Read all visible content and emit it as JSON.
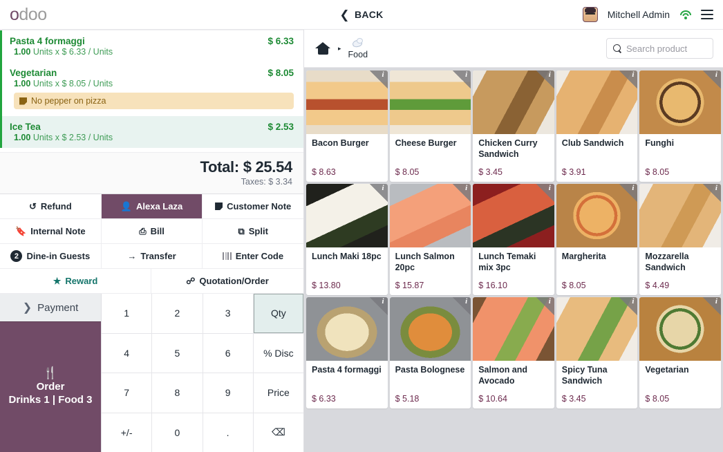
{
  "navbar": {
    "logo_primary": "o",
    "logo_rest": "doo",
    "back_label": "BACK",
    "back_icon": "chevron-left-icon",
    "user_name": "Mitchell Admin",
    "wifi_icon": "wifi-icon",
    "menu_icon": "hamburger-menu-icon",
    "accent_color": "#714B67",
    "wifi_color": "#28a745"
  },
  "order": {
    "lines": [
      {
        "name": "Pasta 4 formaggi",
        "price": "$ 6.33",
        "qty": "1.00",
        "detail": "Units x $ 6.33 / Units",
        "selected": false,
        "note": null
      },
      {
        "name": "Vegetarian",
        "price": "$ 8.05",
        "qty": "1.00",
        "detail": "Units x $ 8.05 / Units",
        "selected": false,
        "note": "No pepper on pizza"
      },
      {
        "name": "Ice Tea",
        "price": "$ 2.53",
        "qty": "1.00",
        "detail": "Units x $ 2.53 / Units",
        "selected": true,
        "note": null
      }
    ],
    "total_label": "Total: $ 25.54",
    "taxes_label": "Taxes: $ 3.34"
  },
  "actions": {
    "rows": [
      [
        {
          "label": "Refund",
          "icon": "refund-icon",
          "glyph": "↺",
          "state": "default"
        },
        {
          "label": "Alexa Laza",
          "icon": "customer-icon",
          "glyph": "👤",
          "state": "active"
        },
        {
          "label": "Customer Note",
          "icon": "note-icon",
          "glyph": "note",
          "state": "default"
        }
      ],
      [
        {
          "label": "Internal Note",
          "icon": "tag-icon",
          "glyph": "🏷",
          "state": "default"
        },
        {
          "label": "Bill",
          "icon": "printer-icon",
          "glyph": "⎙",
          "state": "default"
        },
        {
          "label": "Split",
          "icon": "split-icon",
          "glyph": "⧉",
          "state": "default"
        }
      ],
      [
        {
          "label": "Dine-in Guests",
          "icon": "guests-count-badge",
          "glyph": "2",
          "state": "default"
        },
        {
          "label": "Transfer",
          "icon": "arrow-right-icon",
          "glyph": "→",
          "state": "default"
        },
        {
          "label": "Enter Code",
          "icon": "barcode-icon",
          "glyph": "barcode",
          "state": "default"
        }
      ],
      [
        {
          "label": "Reward",
          "icon": "star-icon",
          "glyph": "★",
          "state": "reward"
        },
        {
          "label": "Quotation/Order",
          "icon": "link-icon",
          "glyph": "%",
          "state": "default"
        }
      ]
    ]
  },
  "payment": {
    "label": "Payment",
    "chevron": "›",
    "order_button": {
      "icon": "cutlery-icon",
      "glyph": "🍴",
      "label": "Order",
      "meta": "Drinks 1 | Food 3"
    },
    "button_color": "#714B67"
  },
  "numpad": {
    "keys": [
      {
        "label": "1",
        "type": "digit",
        "selected": false
      },
      {
        "label": "2",
        "type": "digit",
        "selected": false
      },
      {
        "label": "3",
        "type": "digit",
        "selected": false
      },
      {
        "label": "Qty",
        "type": "mode",
        "selected": true
      },
      {
        "label": "4",
        "type": "digit",
        "selected": false
      },
      {
        "label": "5",
        "type": "digit",
        "selected": false
      },
      {
        "label": "6",
        "type": "digit",
        "selected": false
      },
      {
        "label": "% Disc",
        "type": "mode",
        "selected": false
      },
      {
        "label": "7",
        "type": "digit",
        "selected": false
      },
      {
        "label": "8",
        "type": "digit",
        "selected": false
      },
      {
        "label": "9",
        "type": "digit",
        "selected": false
      },
      {
        "label": "Price",
        "type": "mode",
        "selected": false
      },
      {
        "label": "+/-",
        "type": "sign",
        "selected": false
      },
      {
        "label": "0",
        "type": "digit",
        "selected": false
      },
      {
        "label": ".",
        "type": "digit",
        "selected": false
      },
      {
        "label": "⌫",
        "type": "backspace",
        "selected": false
      }
    ]
  },
  "product_panel": {
    "breadcrumb": {
      "home_icon": "home-icon",
      "separator": "▸",
      "category": "Food",
      "category_icon": "food-category-icon"
    },
    "search": {
      "icon": "search-icon",
      "placeholder": "Search product",
      "value": ""
    },
    "info_badge_label": "i",
    "products": [
      {
        "name": "Bacon Burger",
        "price": "$ 8.63",
        "img": "bacon-burger",
        "c1": "#f2c98a",
        "c2": "#b8512e",
        "c3": "#e8dcc8",
        "shape": "burger"
      },
      {
        "name": "Cheese Burger",
        "price": "$ 8.05",
        "img": "cheese-burger",
        "c1": "#eec98c",
        "c2": "#5f9b3a",
        "c3": "#efe6d6",
        "shape": "burger"
      },
      {
        "name": "Chicken Curry Sandwich",
        "price": "$ 3.45",
        "img": "chicken-curry",
        "c1": "#c79a5e",
        "c2": "#8a6234",
        "c3": "#ece7de",
        "shape": "sandwich"
      },
      {
        "name": "Club Sandwich",
        "price": "$ 3.91",
        "img": "club-sandwich",
        "c1": "#e6b271",
        "c2": "#c98d4c",
        "c3": "#efeae3",
        "shape": "sandwich"
      },
      {
        "name": "Funghi",
        "price": "$ 8.05",
        "img": "funghi-pizza",
        "c1": "#e8b96f",
        "c2": "#5b3b22",
        "c3": "#c28a4a",
        "shape": "pizza"
      },
      {
        "name": "Lunch Maki 18pc",
        "price": "$ 13.80",
        "img": "lunch-maki",
        "c1": "#f4f1e8",
        "c2": "#2e3b22",
        "c3": "#20211c",
        "shape": "sushi"
      },
      {
        "name": "Lunch Salmon 20pc",
        "price": "$ 15.87",
        "img": "lunch-salmon",
        "c1": "#f4a07a",
        "c2": "#e8855f",
        "c3": "#b9bcc0",
        "shape": "sushi"
      },
      {
        "name": "Lunch Temaki mix 3pc",
        "price": "$ 16.10",
        "img": "lunch-temaki",
        "c1": "#d9603f",
        "c2": "#2b3424",
        "c3": "#8c1f1f",
        "shape": "sushi"
      },
      {
        "name": "Margherita",
        "price": "$ 8.05",
        "img": "margherita-pizza",
        "c1": "#edb265",
        "c2": "#d4703a",
        "c3": "#b98448",
        "shape": "pizza"
      },
      {
        "name": "Mozzarella Sandwich",
        "price": "$ 4.49",
        "img": "mozzarella-sandwich",
        "c1": "#e3b579",
        "c2": "#cf9a55",
        "c3": "#f0ece6",
        "shape": "sandwich"
      },
      {
        "name": "Pasta 4 formaggi",
        "price": "$ 6.33",
        "img": "pasta-4-formaggi",
        "c1": "#f0e3bd",
        "c2": "#b9a271",
        "c3": "#8f9296",
        "shape": "pasta"
      },
      {
        "name": "Pasta Bolognese",
        "price": "$ 5.18",
        "img": "pasta-bolognese",
        "c1": "#e08d3c",
        "c2": "#7a8c3e",
        "c3": "#8f9296",
        "shape": "pasta"
      },
      {
        "name": "Salmon and Avocado",
        "price": "$ 10.64",
        "img": "salmon-avocado",
        "c1": "#f0926a",
        "c2": "#88ab4e",
        "c3": "#7a5434",
        "shape": "sandwich"
      },
      {
        "name": "Spicy Tuna Sandwich",
        "price": "$ 3.45",
        "img": "spicy-tuna-sandwich",
        "c1": "#e8bb7e",
        "c2": "#76a248",
        "c3": "#f1ece5",
        "shape": "sandwich"
      },
      {
        "name": "Vegetarian",
        "price": "$ 8.05",
        "img": "vegetarian-pizza",
        "c1": "#e7d6a8",
        "c2": "#4f7a33",
        "c3": "#b9823f",
        "shape": "pizza"
      }
    ]
  }
}
